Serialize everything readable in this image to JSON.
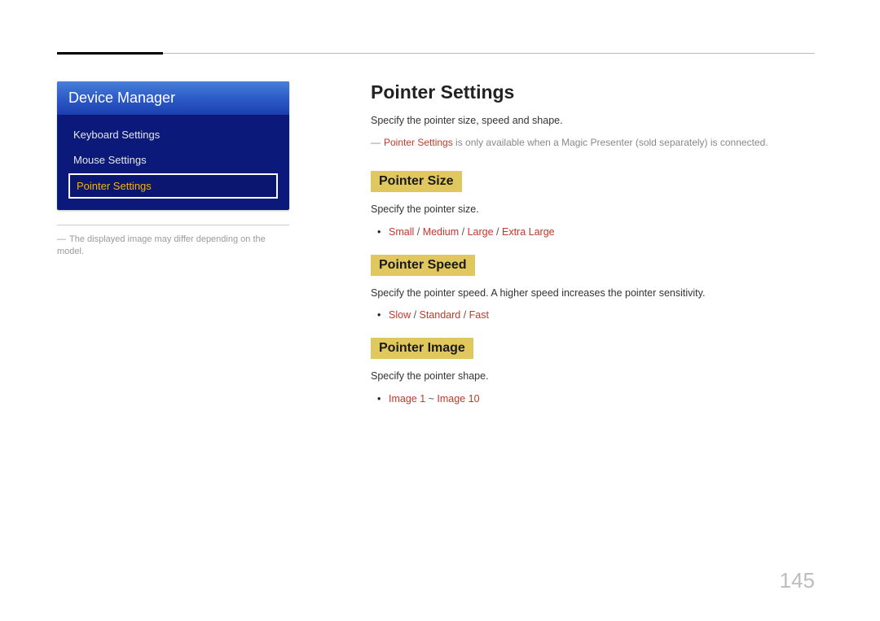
{
  "sidebar": {
    "title": "Device Manager",
    "items": [
      {
        "label": "Keyboard Settings",
        "active": false
      },
      {
        "label": "Mouse Settings",
        "active": false
      },
      {
        "label": "Pointer Settings",
        "active": true
      }
    ],
    "note": "The displayed image may differ depending on the model."
  },
  "content": {
    "title": "Pointer Settings",
    "intro": "Specify the pointer size, speed and shape.",
    "availability": {
      "dash": "―",
      "highlight": "Pointer Settings",
      "rest": " is only available when a Magic Presenter (sold separately) is connected."
    },
    "sections": [
      {
        "heading": "Pointer Size",
        "desc": "Specify the pointer size.",
        "options": [
          "Small",
          "Medium",
          "Large",
          "Extra Large"
        ],
        "separator": " / "
      },
      {
        "heading": "Pointer Speed",
        "desc": "Specify the pointer speed. A higher speed increases the pointer sensitivity.",
        "options": [
          "Slow",
          "Standard",
          "Fast"
        ],
        "separator": " / "
      },
      {
        "heading": "Pointer Image",
        "desc": "Specify the pointer shape.",
        "options": [
          "Image 1",
          "Image 10"
        ],
        "separator": " ~ "
      }
    ]
  },
  "page_number": "145"
}
